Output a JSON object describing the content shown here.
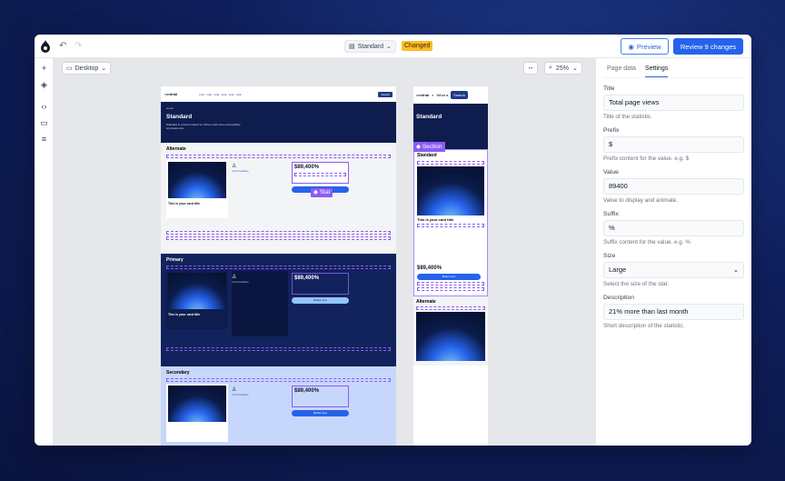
{
  "topbar": {
    "version_label": "Standard",
    "changed_badge": "Changed",
    "preview_label": "Preview",
    "review_label": "Review 9 changes"
  },
  "canvas": {
    "device": "Desktop",
    "zoom": "25%",
    "stat_tag": "Stat",
    "section_tag": "Section"
  },
  "desktop_page": {
    "hero_title": "Standard",
    "sections": {
      "alternate": "Alternate",
      "primary": "Primary",
      "secondary": "Secondary"
    },
    "card_title": "This is your card title",
    "card_headline": "Card headline",
    "stat_value": "$89,400%",
    "button_text": "Button text"
  },
  "mobile_page": {
    "search_label": "Search",
    "what_label": "What a",
    "hero_title": "Standard",
    "section_standard": "Standard",
    "section_alternate": "Alternate",
    "card_title": "This is your card title",
    "stat_value": "$89,400%",
    "button_text": "Button text"
  },
  "panel": {
    "tabs": [
      "Page data",
      "Settings"
    ],
    "active_tab": "Settings",
    "fields": [
      {
        "label": "Title",
        "value": "Total page views",
        "help": "Title of the statistic."
      },
      {
        "label": "Prefix",
        "value": "$",
        "help": "Prefix content for the value. e.g. $"
      },
      {
        "label": "Value",
        "value": "89400",
        "help": "Value to display and animate."
      },
      {
        "label": "Suffix",
        "value": "%",
        "help": "Suffix content for the value. e.g. %"
      },
      {
        "label": "Size",
        "value": "Large",
        "help": "Select the size of the stat."
      },
      {
        "label": "Description",
        "value": "21% more than last month",
        "help": "Short description of the statistic."
      }
    ]
  },
  "colors": {
    "accent": "#2563eb",
    "selection": "#8b5cf6",
    "changed": "#fbbf24",
    "hero": "#0f1d4e"
  }
}
